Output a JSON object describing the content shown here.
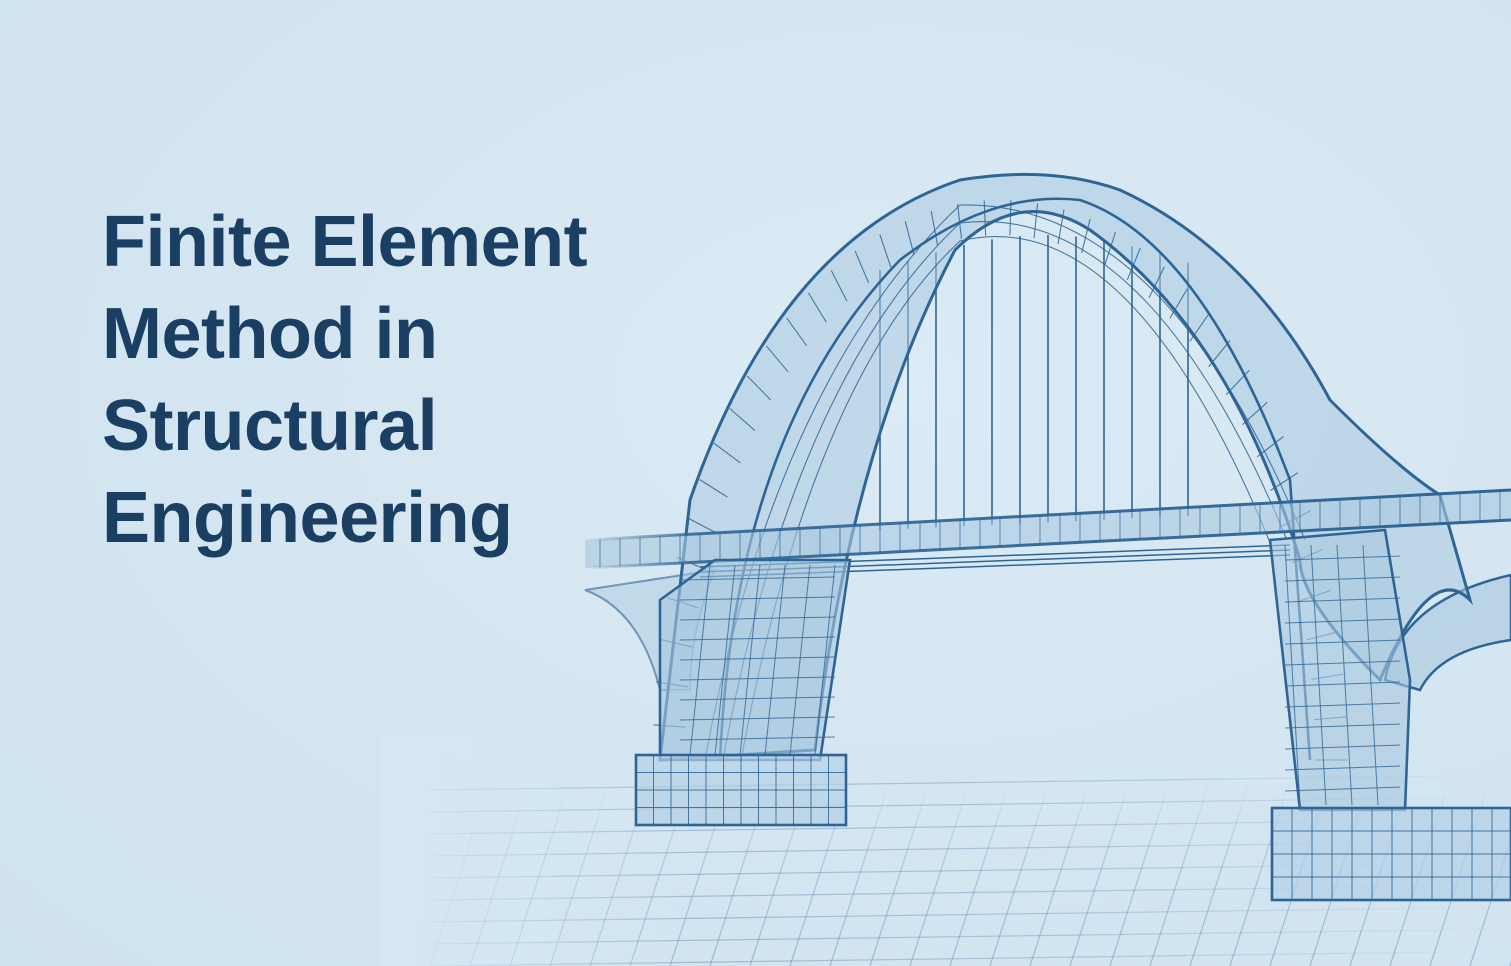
{
  "hero": {
    "title_lines": [
      "Finite Element",
      "Method in",
      "Structural",
      "Engineering"
    ]
  },
  "illustration": {
    "subject": "arch-bridge-wireframe-icon"
  },
  "colors": {
    "background": "#d6e7f2",
    "title": "#1b3e63",
    "mesh_stroke": "#2f6596",
    "mesh_fill": "#a9c8e0"
  }
}
